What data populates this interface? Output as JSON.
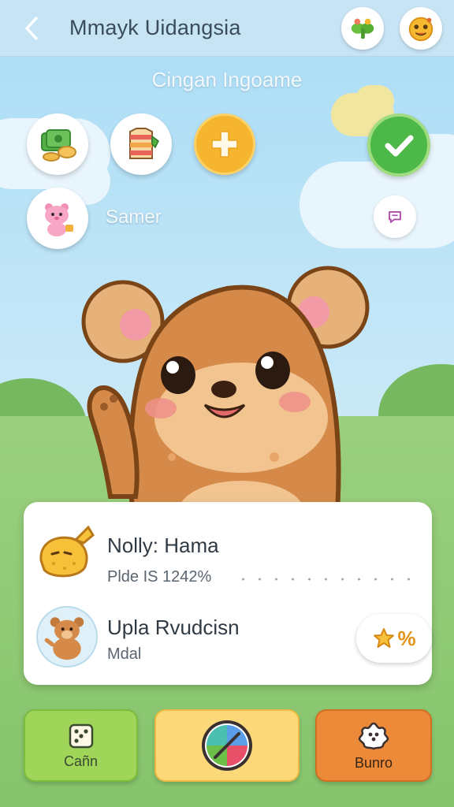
{
  "header": {
    "title": "Mmayk Uidangsia",
    "back_icon": "chevron-left-icon",
    "right_icons": [
      "plant-icon",
      "emoji-face-icon"
    ]
  },
  "subtitle": "Cingan Ingoame",
  "items": [
    {
      "icon": "cash-icon"
    },
    {
      "icon": "shirt-icon"
    },
    {
      "icon": "plus-icon"
    },
    {
      "icon": "check-icon"
    }
  ],
  "pet_row": {
    "label": "Samer",
    "avatar_icon": "pink-cat-icon",
    "chat_icon": "chat-icon"
  },
  "card": {
    "row1": {
      "name": "Nolly: Hama",
      "detail": "Plde IS 1242%",
      "avatar_icon": "chick-icon"
    },
    "row2": {
      "name": "Upla Rvudcisn",
      "detail": "Mdal",
      "avatar_icon": "bear-avatar-icon"
    },
    "rating_label": "%",
    "rating_icon": "star-icon"
  },
  "bottom_buttons": [
    {
      "label": "Cañn",
      "icon": "dice-icon"
    },
    {
      "label": "",
      "icon": "colorful-ball-icon"
    },
    {
      "label": "Bunro",
      "icon": "flower-badge-icon"
    }
  ],
  "colors": {
    "topbar": "#c7e4f5",
    "accent_green": "#4cb848",
    "accent_orange": "#f6b52e",
    "btn_green": "#9fd65a",
    "btn_yellow": "#fbd978",
    "btn_orange": "#ec8a3a"
  }
}
